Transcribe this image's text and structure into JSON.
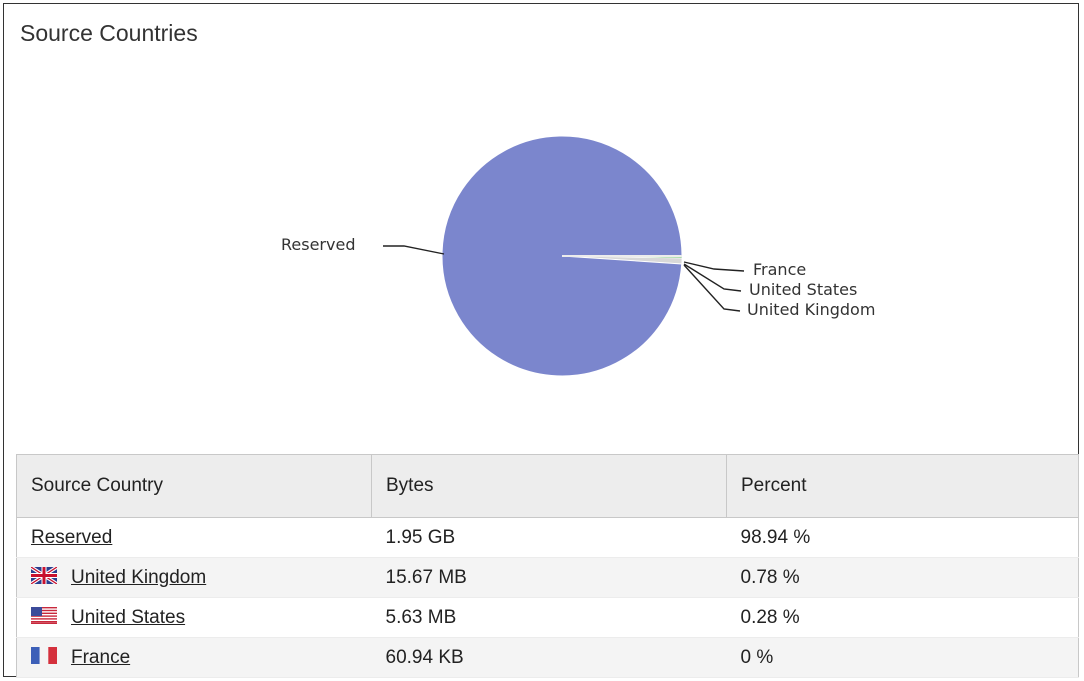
{
  "panel": {
    "title": "Source Countries"
  },
  "chart_data": {
    "type": "pie",
    "slices": [
      {
        "label": "Reserved",
        "value": 98.94,
        "color": "#7b86cd"
      },
      {
        "label": "United Kingdom",
        "value": 0.78,
        "color": "#d8d8d8"
      },
      {
        "label": "United States",
        "value": 0.28,
        "color": "#7dc97d"
      },
      {
        "label": "France",
        "value": 0.0,
        "color": "#e8c8a0"
      }
    ],
    "labels_shown": [
      "Reserved",
      "France",
      "United States",
      "United Kingdom"
    ]
  },
  "table": {
    "headers": [
      "Source Country",
      "Bytes",
      "Percent"
    ],
    "rows": [
      {
        "country": "Reserved",
        "flag": "none",
        "bytes": "1.95 GB",
        "percent": "98.94 %"
      },
      {
        "country": "United Kingdom",
        "flag": "uk-flag-icon",
        "bytes": "15.67 MB",
        "percent": "0.78 %"
      },
      {
        "country": "United States",
        "flag": "us-flag-icon",
        "bytes": "5.63 MB",
        "percent": "0.28 %"
      },
      {
        "country": "France",
        "flag": "france-flag-icon",
        "bytes": "60.94 KB",
        "percent": "0 %"
      }
    ]
  }
}
